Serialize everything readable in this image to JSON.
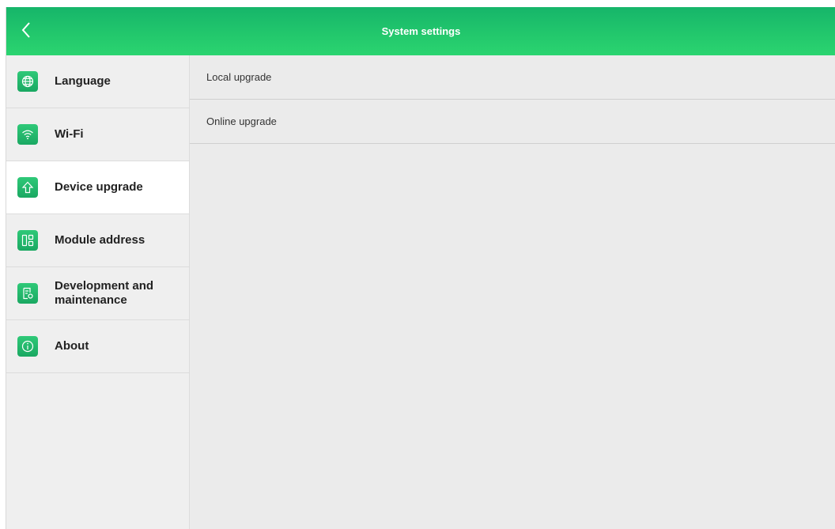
{
  "header": {
    "title": "System settings",
    "back_icon": "chevron-left-icon"
  },
  "sidebar": {
    "items": [
      {
        "label": "Language",
        "icon": "globe-icon"
      },
      {
        "label": "Wi-Fi",
        "icon": "wifi-icon"
      },
      {
        "label": "Device upgrade",
        "icon": "upgrade-arrow-icon",
        "active": true
      },
      {
        "label": "Module address",
        "icon": "module-grid-icon"
      },
      {
        "label": "Development and maintenance",
        "icon": "document-gear-icon"
      },
      {
        "label": "About",
        "icon": "info-icon"
      }
    ]
  },
  "main": {
    "rows": [
      {
        "label": "Local upgrade",
        "arrow": "›"
      },
      {
        "label": "Online upgrade",
        "arrow": "›"
      }
    ]
  },
  "colors": {
    "accent": "#22c76c",
    "sidebar_bg": "#efefef",
    "content_bg": "#ebebeb",
    "active_bg": "#ffffff"
  }
}
